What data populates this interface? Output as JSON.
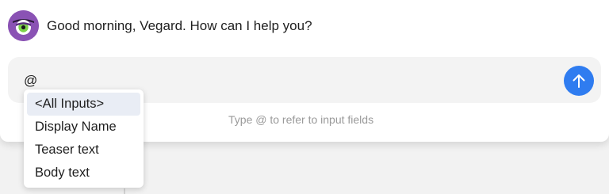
{
  "assistant": {
    "greeting": "Good morning, Vegard. How can I help you?"
  },
  "composer": {
    "input_value": "@",
    "hint": "Type @ to refer to input fields",
    "send_icon": "arrow-up-icon"
  },
  "mention_menu": {
    "items": [
      {
        "label": "<All Inputs>",
        "active": true
      },
      {
        "label": "Display Name",
        "active": false
      },
      {
        "label": "Teaser text",
        "active": false
      },
      {
        "label": "Body text",
        "active": false
      }
    ]
  },
  "colors": {
    "accent": "#2f7cf0",
    "avatar": "#8a52b4",
    "avatar_eye": "#7dd34a"
  }
}
